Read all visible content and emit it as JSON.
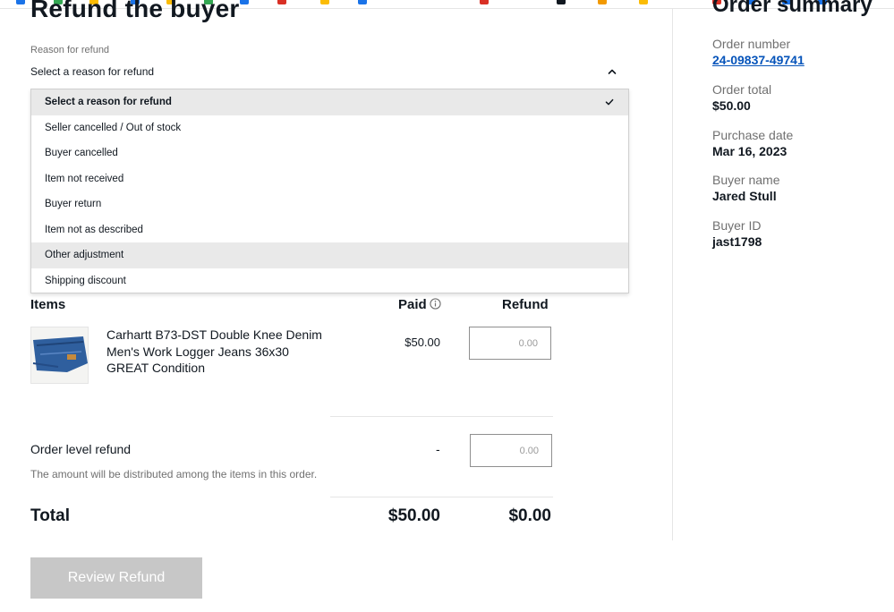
{
  "page": {
    "title": "Refund the buyer"
  },
  "reason": {
    "label": "Reason for refund",
    "selected": "Select a reason for refund",
    "options": [
      "Select a reason for refund",
      "Seller cancelled / Out of stock",
      "Buyer cancelled",
      "Item not received",
      "Buyer return",
      "Item not as described",
      "Other adjustment",
      "Shipping discount"
    ]
  },
  "table": {
    "col_items": "Items",
    "col_paid": "Paid",
    "col_refund": "Refund"
  },
  "item": {
    "title": "Carhartt B73-DST Double Knee Denim Men's Work Logger Jeans 36x30 GREAT Condition",
    "paid": "$50.00",
    "refund_placeholder": "0.00"
  },
  "order_level": {
    "label": "Order level refund",
    "paid": "-",
    "refund_placeholder": "0.00",
    "note": "The amount will be distributed among the items in this order."
  },
  "total": {
    "label": "Total",
    "paid": "$50.00",
    "refund": "$0.00"
  },
  "actions": {
    "review_label": "Review Refund"
  },
  "summary": {
    "title": "Order summary",
    "order_number_label": "Order number",
    "order_number": "24-09837-49741",
    "order_total_label": "Order total",
    "order_total": "$50.00",
    "purchase_date_label": "Purchase date",
    "purchase_date": "Mar 16, 2023",
    "buyer_name_label": "Buyer name",
    "buyer_name": "Jared Stull",
    "buyer_id_label": "Buyer ID",
    "buyer_id": "jast1798"
  },
  "colors": {
    "text": "#111820",
    "muted": "#707070",
    "link": "#0654ba",
    "disabled_button": "#c7c7c7",
    "dropdown_highlight": "#e9e9e9"
  }
}
